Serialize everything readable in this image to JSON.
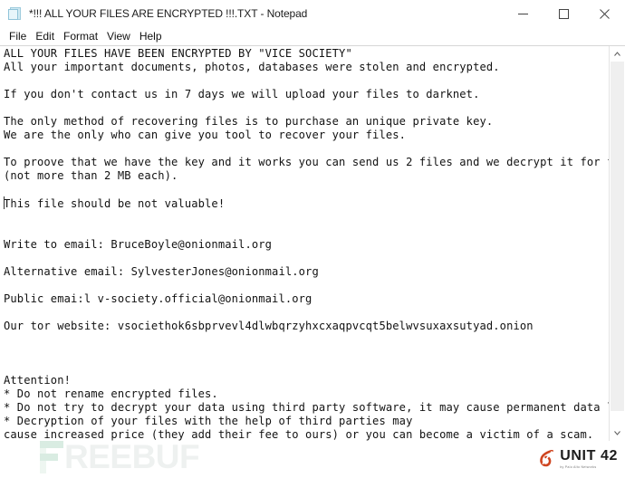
{
  "window": {
    "title": "*!!! ALL YOUR FILES ARE ENCRYPTED !!!.TXT - Notepad",
    "app_icon": "notepad-document-icon",
    "controls": {
      "minimize": "minimize-icon",
      "maximize": "maximize-icon",
      "close": "close-icon"
    }
  },
  "menu": {
    "items": [
      {
        "label": "File"
      },
      {
        "label": "Edit"
      },
      {
        "label": "Format"
      },
      {
        "label": "View"
      },
      {
        "label": "Help"
      }
    ]
  },
  "editor": {
    "ransom_note": "ALL YOUR FILES HAVE BEEN ENCRYPTED BY \"VICE SOCIETY\"\nAll your important documents, photos, databases were stolen and encrypted.\n\nIf you don't contact us in 7 days we will upload your files to darknet.\n\nThe only method of recovering files is to purchase an unique private key.\nWe are the only who can give you tool to recover your files.\n\nTo proove that we have the key and it works you can send us 2 files and we decrypt it for free\n(not more than 2 MB each).\n\nThis file should be not valuable!\n\n\nWrite to email: BruceBoyle@onionmail.org\n\nAlternative email: SylvesterJones@onionmail.org\n\nPublic emai:l v-society.official@onionmail.org\n\nOur tor website: vsociethok6sbprvevl4dlwbqrzyhxcxaqpvcqt5belwvsuxaxsutyad.onion\n\n\n\nAttention!\n* Do not rename encrypted files.\n* Do not try to decrypt your data using third party software, it may cause permanent data loss.\n* Decryption of your files with the help of third parties may\ncause increased price (they add their fee to ours) or you can become a victim of a scam.",
    "threat_actor": "VICE SOCIETY",
    "deadline_days": 7,
    "free_decrypt_file_count": 2,
    "free_decrypt_max_size": "2 MB",
    "contact_email_primary": "BruceBoyle@onionmail.org",
    "contact_email_alternative": "SylvesterJones@onionmail.org",
    "contact_email_public": "v-society.official@onionmail.org",
    "tor_website": "vsociethok6sbprvevl4dlwbqrzyhxcxaqpvcqt5belwvsuxaxsutyad.onion"
  },
  "scrollbar": {
    "up_arrow": "chevron-up-icon",
    "down_arrow": "chevron-down-icon"
  },
  "watermarks": {
    "freebuf": {
      "text": "REEBUF"
    },
    "unit42": {
      "name": "UNIT 42",
      "tagline": "by Palo Alto Networks"
    }
  },
  "colors": {
    "accent_unit42": "#cf4520",
    "freebuf_green": "#d9ece2",
    "text": "#121212",
    "window_bg": "#ffffff"
  }
}
